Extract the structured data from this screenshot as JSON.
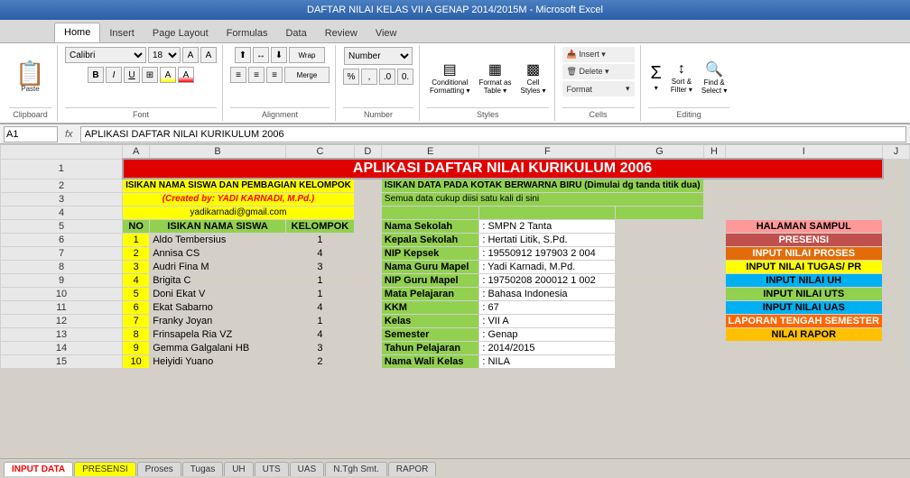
{
  "titleBar": {
    "text": "DAFTAR NILAI KELAS VII A GENAP 2014/2015M - Microsoft Excel"
  },
  "ribbon": {
    "tabs": [
      "Home",
      "Insert",
      "Page Layout",
      "Formulas",
      "Data",
      "Review",
      "View"
    ],
    "activeTab": "Home",
    "sections": {
      "clipboard": {
        "label": "Clipboard",
        "paste": "Paste"
      },
      "font": {
        "label": "Font",
        "fontName": "Calibri",
        "fontSize": "18",
        "bold": "B",
        "italic": "I",
        "underline": "U"
      },
      "alignment": {
        "label": "Alignment"
      },
      "number": {
        "label": "Number",
        "format": "Number"
      },
      "styles": {
        "label": "Styles",
        "conditional": "Conditional\nFormatting",
        "formatTable": "Format as\nTable",
        "cellStyles": "Cell\nStyles"
      },
      "cells": {
        "label": "Cells",
        "insert": "Insert",
        "delete": "Delete",
        "format": "Format"
      },
      "editing": {
        "label": "Editing",
        "sum": "Σ",
        "sort": "Sort &\nFilter",
        "find": "Find &\nSelect"
      }
    }
  },
  "formulaBar": {
    "nameBox": "A1",
    "formula": "APLIKASI DAFTAR NILAI KURIKULUM 2006"
  },
  "sheet": {
    "columns": [
      "A",
      "B",
      "C",
      "D",
      "E",
      "F",
      "G",
      "H",
      "I",
      "J"
    ],
    "title": "APLIKASI DAFTAR NILAI KURIKULUM 2006",
    "row2a": "ISIKAN NAMA SISWA DAN PEMBAGIAN KELOMPOK",
    "row2b": "ISIKAN DATA PADA KOTAK BERWARNA BIRU (Dimulai dg tanda titik dua)",
    "row3a": "(Created by: YADI KARNADI, M.Pd.)",
    "row3b": "Semua data cukup diisi satu kali di sini",
    "row4a": "yadikarnadi@gmail.com",
    "headers": {
      "no": "NO",
      "nama": "ISIKAN NAMA SISWA",
      "kelompok": "KELOMPOK"
    },
    "infoLabels": {
      "namaSekolah": "Nama Sekolah",
      "kepalaSekolah": "Kepala Sekolah",
      "nipKepsek": "NIP Kepsek",
      "namaGuruMapel": "Nama Guru Mapel",
      "nipGuruMapel": "NIP Guru Mapel",
      "mataPelajaran": "Mata Pelajaran",
      "kkm": "KKM",
      "kelas": "Kelas",
      "semester": "Semester",
      "tahunPelajaran": "Tahun Pelajaran",
      "namaWaliKelas": "Nama Wali Kelas"
    },
    "infoValues": {
      "namaSekolah": ": SMPN 2 Tanta",
      "kepalaSekolah": ": Hertati Litik, S.Pd.",
      "nipKepsek": ": 19550912 197903 2 004",
      "namaGuruMapel": ": Yadi Karnadi, M.Pd.",
      "nipGuruMapel": ": 19750208 200012 1 002",
      "mataPelajaran": ": Bahasa Indonesia",
      "kkm": ": 67",
      "kelas": ": VII A",
      "semester": ": Genap",
      "tahunPelajaran": ": 2014/2015",
      "namaWaliKelas": ": NILA"
    },
    "students": [
      {
        "no": 1,
        "nama": "Aldo Tembersius",
        "kelompok": 1
      },
      {
        "no": 2,
        "nama": "Annisa CS",
        "kelompok": 4
      },
      {
        "no": 3,
        "nama": "Audri Fina M",
        "kelompok": 3
      },
      {
        "no": 4,
        "nama": "Brigita C",
        "kelompok": 1
      },
      {
        "no": 5,
        "nama": "Doni Ekat V",
        "kelompok": 1
      },
      {
        "no": 6,
        "nama": "Ekat Sabarno",
        "kelompok": 4
      },
      {
        "no": 7,
        "nama": "Franky Joyan",
        "kelompok": 1
      },
      {
        "no": 8,
        "nama": "Frinsapela Ria VZ",
        "kelompok": 4
      },
      {
        "no": 9,
        "nama": "Gemma Galgalani HB",
        "kelompok": 3
      },
      {
        "no": 10,
        "nama": "Heiyidi Yuano",
        "kelompok": 2
      }
    ],
    "navButtons": [
      {
        "label": "HALAMAN SAMPUL",
        "class": "btn-halaman"
      },
      {
        "label": "PRESENSI",
        "class": "btn-presensi"
      },
      {
        "label": "INPUT NILAI PROSES",
        "class": "btn-proses"
      },
      {
        "label": "INPUT NILAI TUGAS/ PR",
        "class": "btn-tugas"
      },
      {
        "label": "INPUT NILAI UH",
        "class": "btn-uh"
      },
      {
        "label": "INPUT NILAI UTS",
        "class": "btn-uts"
      },
      {
        "label": "INPUT NILAI UAS",
        "class": "btn-uas"
      },
      {
        "label": "LAPORAN TENGAH SEMESTER",
        "class": "btn-tengah"
      },
      {
        "label": "NILAI RAPOR",
        "class": "btn-rapor"
      }
    ]
  },
  "sheetTabs": [
    {
      "label": "INPUT DATA",
      "class": "active"
    },
    {
      "label": "PRESENSI",
      "class": "yellow"
    },
    {
      "label": "Proses",
      "class": "proses"
    },
    {
      "label": "Tugas",
      "class": "tugas"
    },
    {
      "label": "UH",
      "class": "uh"
    },
    {
      "label": "UTS",
      "class": "uts"
    },
    {
      "label": "UAS",
      "class": "uas"
    },
    {
      "label": "N.Tgh Smt.",
      "class": "ntgh"
    },
    {
      "label": "RAPOR",
      "class": "rapor"
    }
  ]
}
